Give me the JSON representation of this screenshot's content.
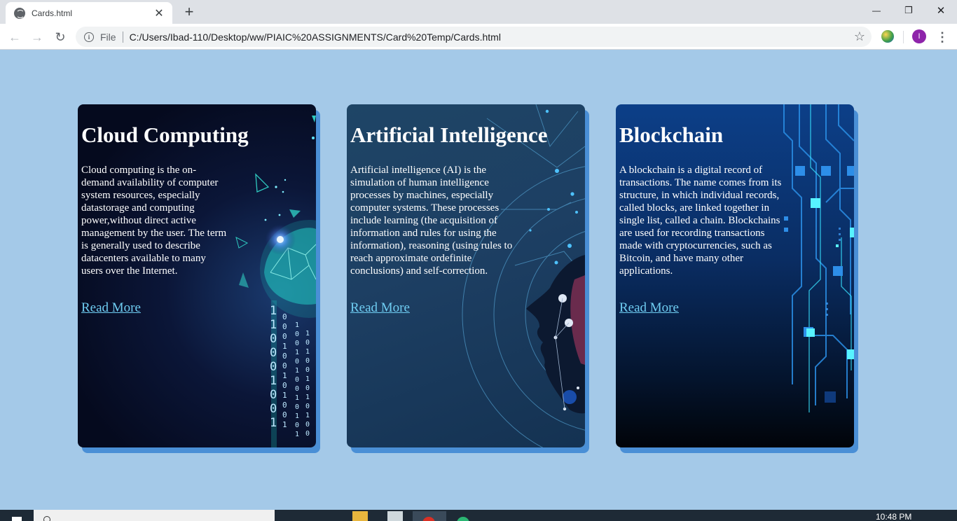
{
  "browser": {
    "tab_title": "Cards.html",
    "tab_close": "✕",
    "new_tab": "+",
    "minimize": "—",
    "restore": "❐",
    "close": "✕",
    "back": "←",
    "forward": "→",
    "reload": "↻",
    "info": "i",
    "scheme_label": "File",
    "url": "C:/Users/Ibad-110/Desktop/ww/PIAIC%20ASSIGNMENTS/Card%20Temp/Cards.html",
    "star": "☆",
    "profile_initial": "I",
    "menu": "⋮"
  },
  "cards": [
    {
      "title": "Cloud Computing",
      "body": "Cloud computing is the on-demand availability of computer system resources, especially datastorage and computing power,without direct active management by the user. The term is generally used to describe datacenters available to many users over the Internet.",
      "link": "Read More"
    },
    {
      "title": "Artificial Intelligence",
      "body": "Artificial intelligence (AI) is the simulation of human intelligence processes by machines, especially computer systems. These processes include learning (the acquisition of information and rules for using the information), reasoning (using rules to reach approximate ordefinite conclusions) and self-correction.",
      "link": "Read More"
    },
    {
      "title": "Blockchain",
      "body": "A blockchain is a digital record of transactions. The name comes from its structure, in which individual records, called blocks, are linked together in single list, called a chain. Blockchains are used for recording transactions made with cryptocurrencies, such as Bitcoin, and have many other applications.",
      "link": "Read More"
    }
  ],
  "binary_digits": [
    "1",
    "1",
    "0",
    "0",
    "0",
    "1",
    "0",
    "0",
    "1",
    "0",
    "1",
    "0",
    "0",
    "1",
    "0",
    "1",
    "0",
    "1",
    "0",
    "0",
    "1",
    "0",
    "1"
  ],
  "taskbar": {
    "clock": "10:48 PM"
  },
  "colors": {
    "page_background": "#a4c9e8",
    "card_shadow": "#4a8fd6",
    "link": "#6fcdf2"
  }
}
